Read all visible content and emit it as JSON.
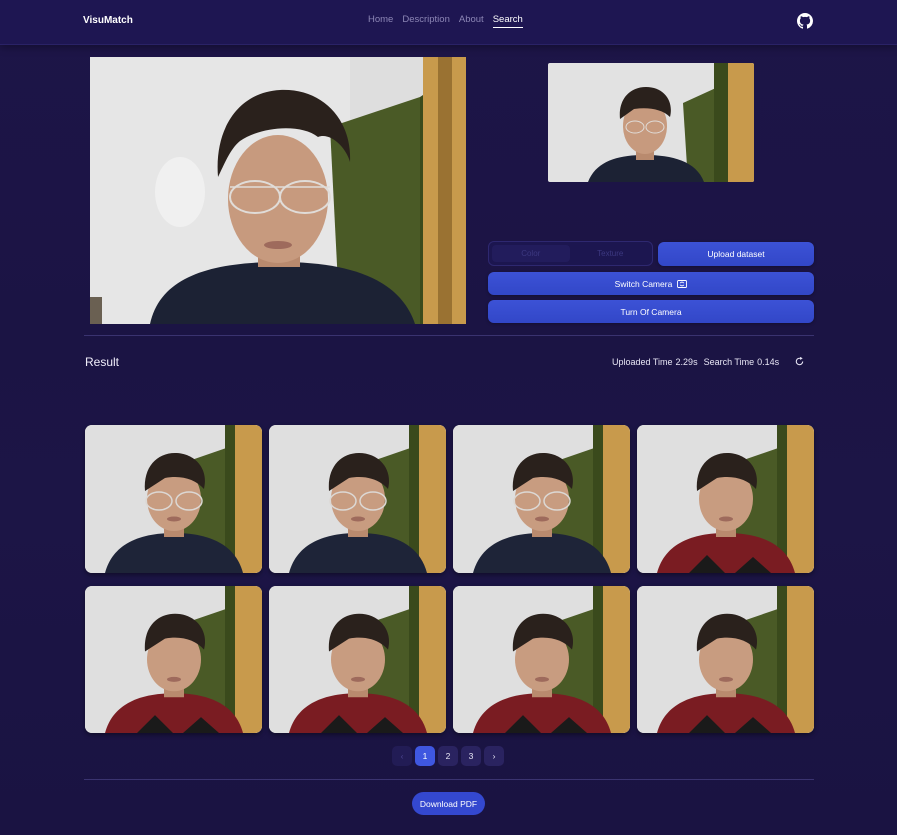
{
  "navbar": {
    "brand": "VisuMatch",
    "links": [
      {
        "label": "Home",
        "active": false
      },
      {
        "label": "Description",
        "active": false
      },
      {
        "label": "About",
        "active": false
      },
      {
        "label": "Search",
        "active": true
      }
    ],
    "github_icon": "github-icon"
  },
  "camera": {
    "main_feed": "webcam-live-image",
    "preview": "captured-frame-image"
  },
  "controls": {
    "mode_options": [
      "Color",
      "Texture"
    ],
    "selected_mode": "Color",
    "upload_label": "Upload dataset",
    "switch_camera_label": "Switch Camera",
    "switch_camera_icon": "camera-switch-icon",
    "turn_off_label": "Turn Of Camera"
  },
  "result": {
    "title": "Result",
    "uploaded_time_label": "Uploaded Time",
    "uploaded_time": "2.29s",
    "search_time_label": "Search Time",
    "search_time": "0.14s",
    "refresh_icon": "refresh-icon",
    "images": [
      {
        "shirt": "#1e2438",
        "glasses": true
      },
      {
        "shirt": "#1e2438",
        "glasses": true
      },
      {
        "shirt": "#1e2438",
        "glasses": true
      },
      {
        "shirt": "#7a1c22",
        "glasses": false
      },
      {
        "shirt": "#7a1c22",
        "glasses": false
      },
      {
        "shirt": "#7a1c22",
        "glasses": false
      },
      {
        "shirt": "#7a1c22",
        "glasses": false
      },
      {
        "shirt": "#7a1c22",
        "glasses": false
      }
    ]
  },
  "pagination": {
    "prev": "‹",
    "pages": [
      "1",
      "2",
      "3"
    ],
    "current": "1",
    "next": "›"
  },
  "download_label": "Download PDF",
  "colors": {
    "accent": "#3f57e0",
    "background": "#1a1342"
  }
}
